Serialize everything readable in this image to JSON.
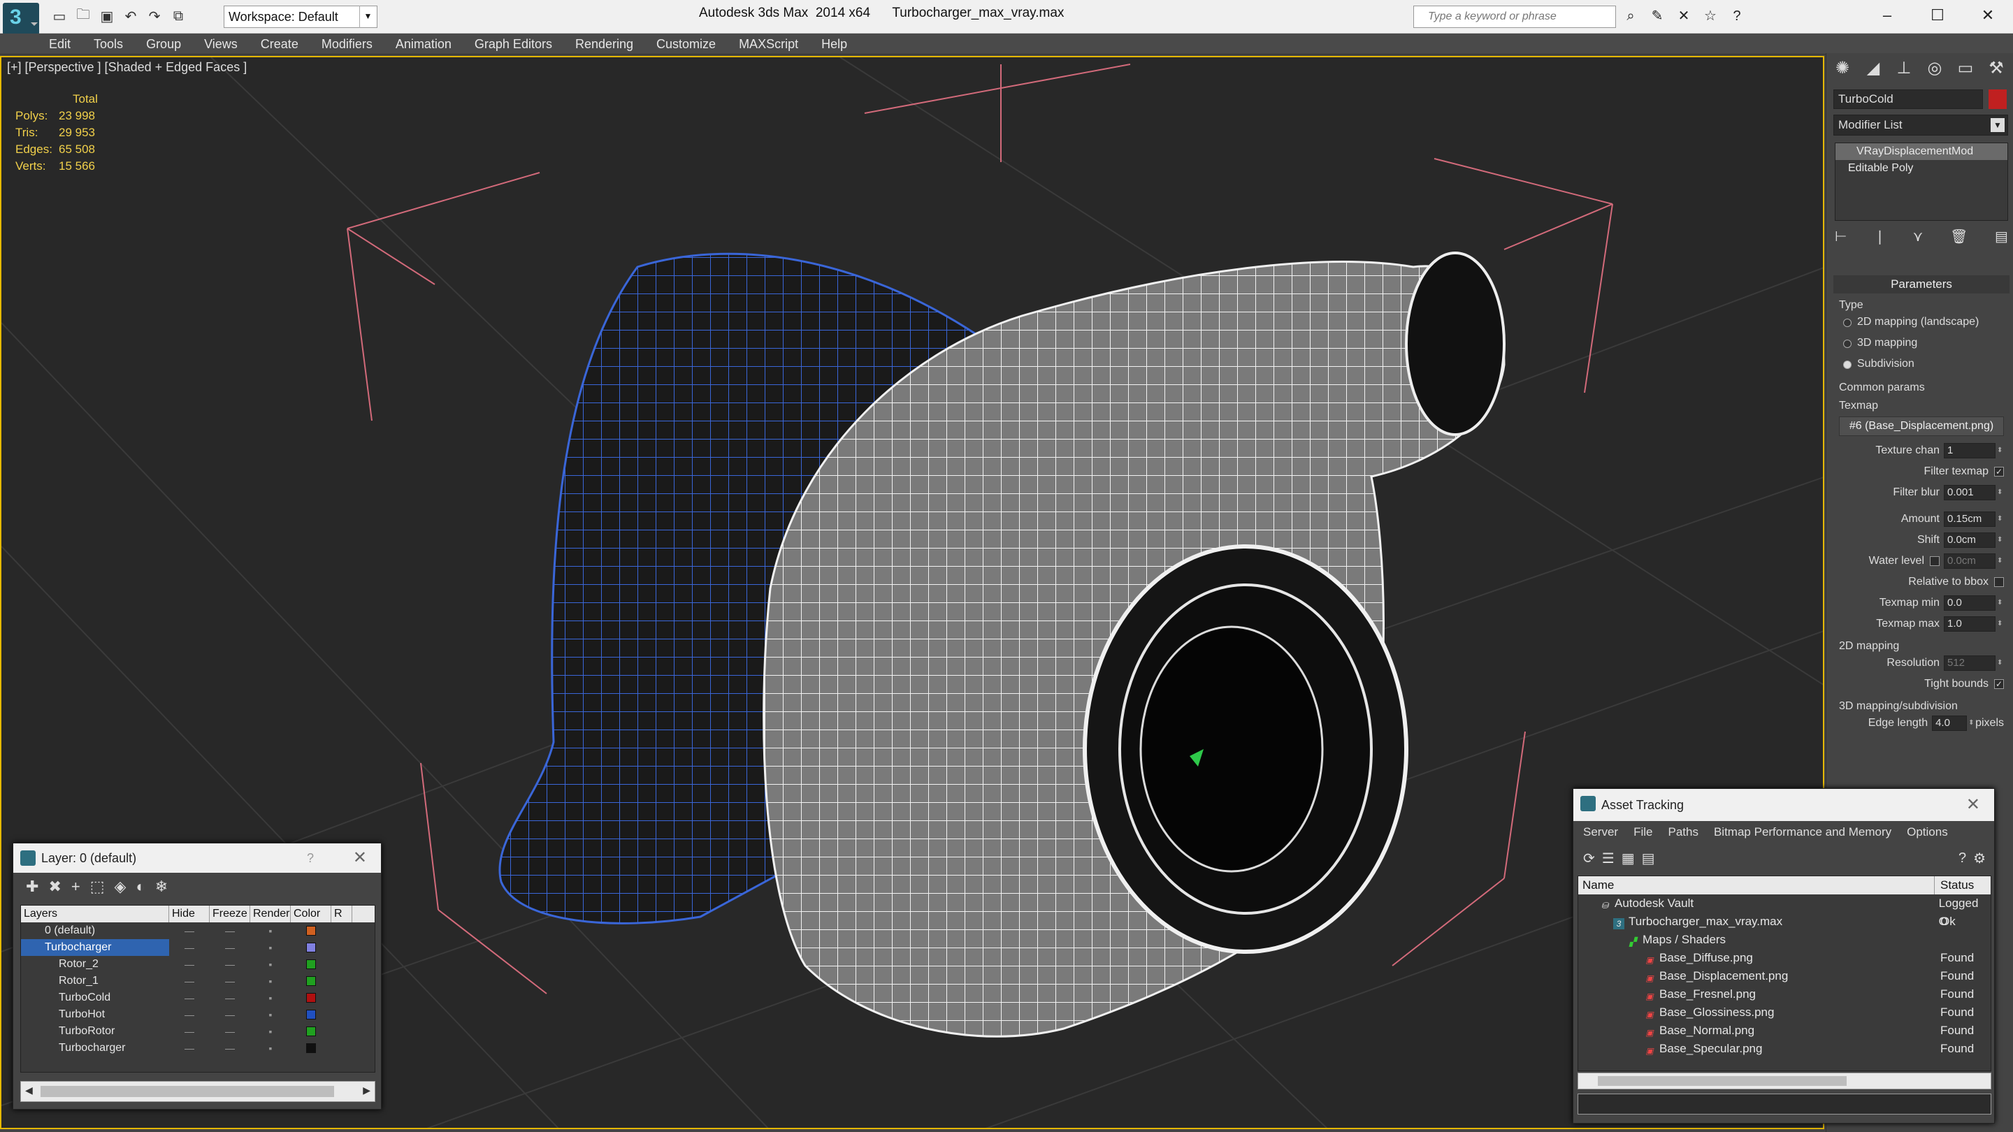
{
  "titlebar": {
    "workspace": "Workspace: Default",
    "title": "Autodesk 3ds Max  2014 x64      Turbocharger_max_vray.max",
    "search_placeholder": "Type a keyword or phrase"
  },
  "menu": [
    "Edit",
    "Tools",
    "Group",
    "Views",
    "Create",
    "Modifiers",
    "Animation",
    "Graph Editors",
    "Rendering",
    "Customize",
    "MAXScript",
    "Help"
  ],
  "viewport": {
    "label": "[+] [Perspective ] [Shaded + Edged Faces ]",
    "stats_header": "Total",
    "stats": [
      {
        "k": "Polys:",
        "v": "23 998"
      },
      {
        "k": "Tris:",
        "v": "29 953"
      },
      {
        "k": "Edges:",
        "v": "65 508"
      },
      {
        "k": "Verts:",
        "v": "15 566"
      }
    ]
  },
  "cmdpanel": {
    "object_name": "TurboCold",
    "object_color": "#c02020",
    "modifier_list": "Modifier List",
    "stack": [
      "VRayDisplacementMod",
      "Editable Poly"
    ],
    "rollout": "Parameters",
    "type_label": "Type",
    "type_options": [
      "2D mapping (landscape)",
      "3D mapping",
      "Subdivision"
    ],
    "common_label": "Common params",
    "texmap_label": "Texmap",
    "texmap_value": "#6 (Base_Displacement.png)",
    "texture_chan_label": "Texture chan",
    "texture_chan": "1",
    "filter_texmap_label": "Filter texmap",
    "filter_blur_label": "Filter blur",
    "filter_blur": "0.001",
    "amount_label": "Amount",
    "amount": "0.15cm",
    "shift_label": "Shift",
    "shift": "0.0cm",
    "water_label": "Water level",
    "water": "0.0cm",
    "relbbox_label": "Relative to bbox",
    "texmin_label": "Texmap min",
    "texmin": "0.0",
    "texmax_label": "Texmap max",
    "texmax": "1.0",
    "mapping2d_label": "2D mapping",
    "resolution_label": "Resolution",
    "resolution": "512",
    "tight_label": "Tight bounds",
    "mapping3d_label": "3D mapping/subdivision",
    "edge_label": "Edge length",
    "edge": "4.0",
    "pixels": "pixels"
  },
  "layers": {
    "title": "Layer: 0 (default)",
    "help": "?",
    "headers": [
      "Layers",
      "Hide",
      "Freeze",
      "Render",
      "Color",
      "R"
    ],
    "rows": [
      {
        "name": "0 (default)",
        "color": "#d06020"
      },
      {
        "name": "Turbocharger",
        "color": "#8080e0"
      },
      {
        "name": "Rotor_2",
        "color": "#20a020"
      },
      {
        "name": "Rotor_1",
        "color": "#20a020"
      },
      {
        "name": "TurboCold",
        "color": "#b01010"
      },
      {
        "name": "TurboHot",
        "color": "#2050c0"
      },
      {
        "name": "TurboRotor",
        "color": "#20a020"
      },
      {
        "name": "Turbocharger",
        "color": "#101010"
      }
    ]
  },
  "assets": {
    "title": "Asset Tracking",
    "menu": [
      "Server",
      "File",
      "Paths",
      "Bitmap Performance and Memory",
      "Options"
    ],
    "headers": {
      "name": "Name",
      "status": "Status"
    },
    "rows": [
      {
        "name": "Autodesk Vault",
        "status": "Logged O"
      },
      {
        "name": "Turbocharger_max_vray.max",
        "status": "Ok"
      },
      {
        "name": "Maps / Shaders",
        "status": ""
      },
      {
        "name": "Base_Diffuse.png",
        "status": "Found"
      },
      {
        "name": "Base_Displacement.png",
        "status": "Found"
      },
      {
        "name": "Base_Fresnel.png",
        "status": "Found"
      },
      {
        "name": "Base_Glossiness.png",
        "status": "Found"
      },
      {
        "name": "Base_Normal.png",
        "status": "Found"
      },
      {
        "name": "Base_Specular.png",
        "status": "Found"
      }
    ]
  }
}
